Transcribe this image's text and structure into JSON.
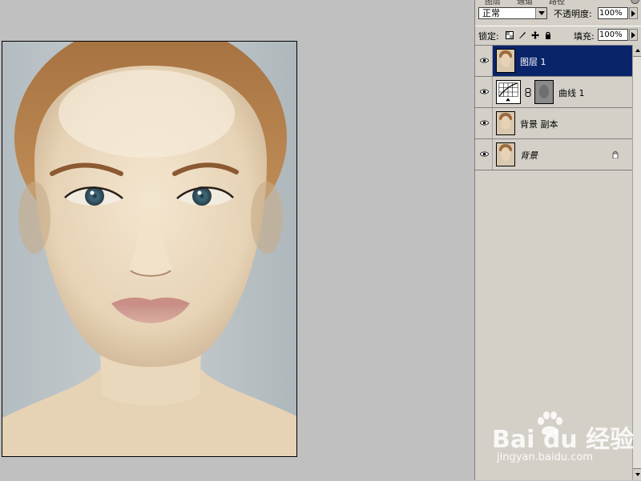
{
  "colors": {
    "workspace": "#c0c0c0",
    "panel": "#d4d0c8",
    "selection": "#0a246a",
    "watermark": "#ffffff"
  },
  "panel": {
    "tabs": [
      "图层",
      "通道",
      "路径"
    ],
    "blend_mode": "正常",
    "opacity_label": "不透明度:",
    "opacity_value": "100%",
    "lock_label": "锁定:",
    "lock_icons": [
      "lock-transparent-icon",
      "lock-paint-icon",
      "lock-move-icon",
      "lock-all-icon"
    ],
    "fill_label": "填充:",
    "fill_value": "100%"
  },
  "layers": [
    {
      "name": "图层 1",
      "visible": true,
      "selected": true,
      "italic": false,
      "thumbnail": "face-thumbnail"
    },
    {
      "name": "曲线 1",
      "visible": true,
      "selected": false,
      "italic": false,
      "thumbnail": "curves-adjustment",
      "mask": "face-mask-thumbnail"
    },
    {
      "name": "背景 副本",
      "visible": true,
      "selected": false,
      "italic": false,
      "thumbnail": "face-thumbnail"
    },
    {
      "name": "背景",
      "visible": true,
      "selected": false,
      "italic": true,
      "thumbnail": "face-thumbnail",
      "locked": true
    }
  ],
  "watermark": {
    "brand": "Bai du 经验",
    "url": "jingyan.baidu.com"
  }
}
